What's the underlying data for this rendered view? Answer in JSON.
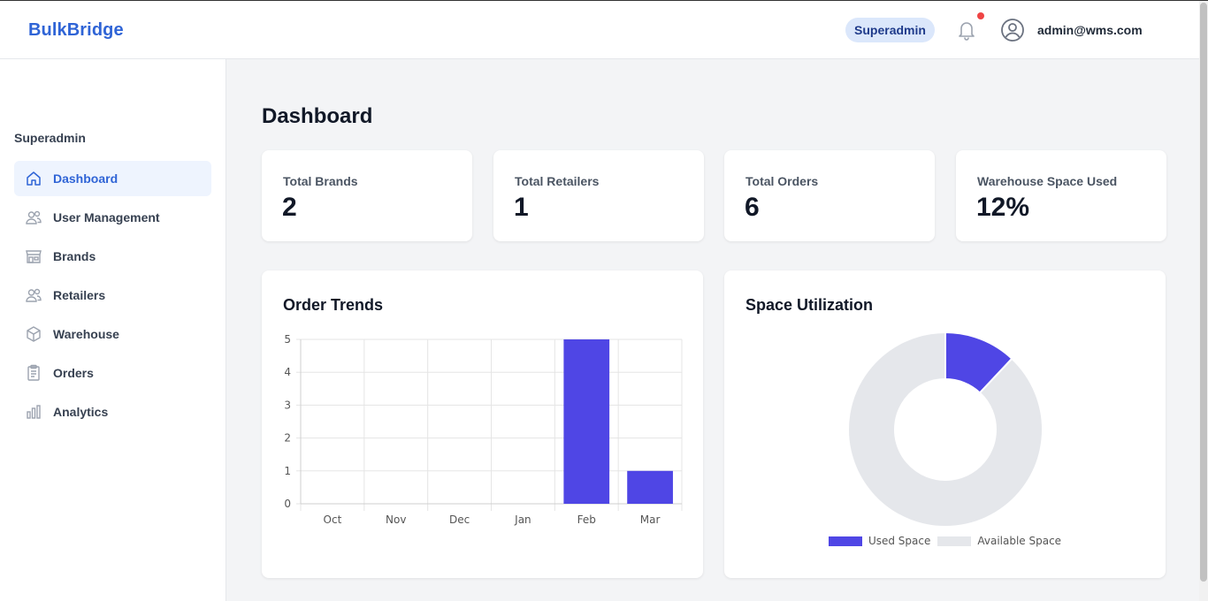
{
  "header": {
    "logo": "BulkBridge",
    "role_badge": "Superadmin",
    "user_email": "admin@wms.com"
  },
  "sidebar": {
    "section_title": "Superadmin",
    "items": [
      {
        "label": "Dashboard",
        "icon": "home-icon",
        "active": true
      },
      {
        "label": "User Management",
        "icon": "users-icon",
        "active": false
      },
      {
        "label": "Brands",
        "icon": "store-icon",
        "active": false
      },
      {
        "label": "Retailers",
        "icon": "users-icon",
        "active": false
      },
      {
        "label": "Warehouse",
        "icon": "box-icon",
        "active": false
      },
      {
        "label": "Orders",
        "icon": "clipboard-icon",
        "active": false
      },
      {
        "label": "Analytics",
        "icon": "bar-chart-icon",
        "active": false
      }
    ]
  },
  "main": {
    "title": "Dashboard",
    "stats": [
      {
        "label": "Total Brands",
        "value": "2"
      },
      {
        "label": "Total Retailers",
        "value": "1"
      },
      {
        "label": "Total Orders",
        "value": "6"
      },
      {
        "label": "Warehouse Space Used",
        "value": "12%"
      }
    ],
    "order_trends_title": "Order Trends",
    "space_title": "Space Utilization"
  },
  "colors": {
    "brand": "#2f64d6",
    "bar": "#4f46e5",
    "available": "#e5e7eb",
    "badge_bg": "#dbe7fb",
    "notification_dot": "#ef4444"
  },
  "chart_data": [
    {
      "type": "bar",
      "title": "Order Trends",
      "categories": [
        "Oct",
        "Nov",
        "Dec",
        "Jan",
        "Feb",
        "Mar"
      ],
      "values": [
        0,
        0,
        0,
        0,
        5,
        1
      ],
      "ylim": [
        0,
        5
      ],
      "yticks": [
        "0",
        "1",
        "2",
        "3",
        "4",
        "5"
      ],
      "grid": true
    },
    {
      "type": "pie",
      "title": "Space Utilization",
      "labels": [
        "Used Space",
        "Available Space"
      ],
      "values": [
        12,
        88
      ],
      "donut": true,
      "legend": "bottom"
    }
  ]
}
